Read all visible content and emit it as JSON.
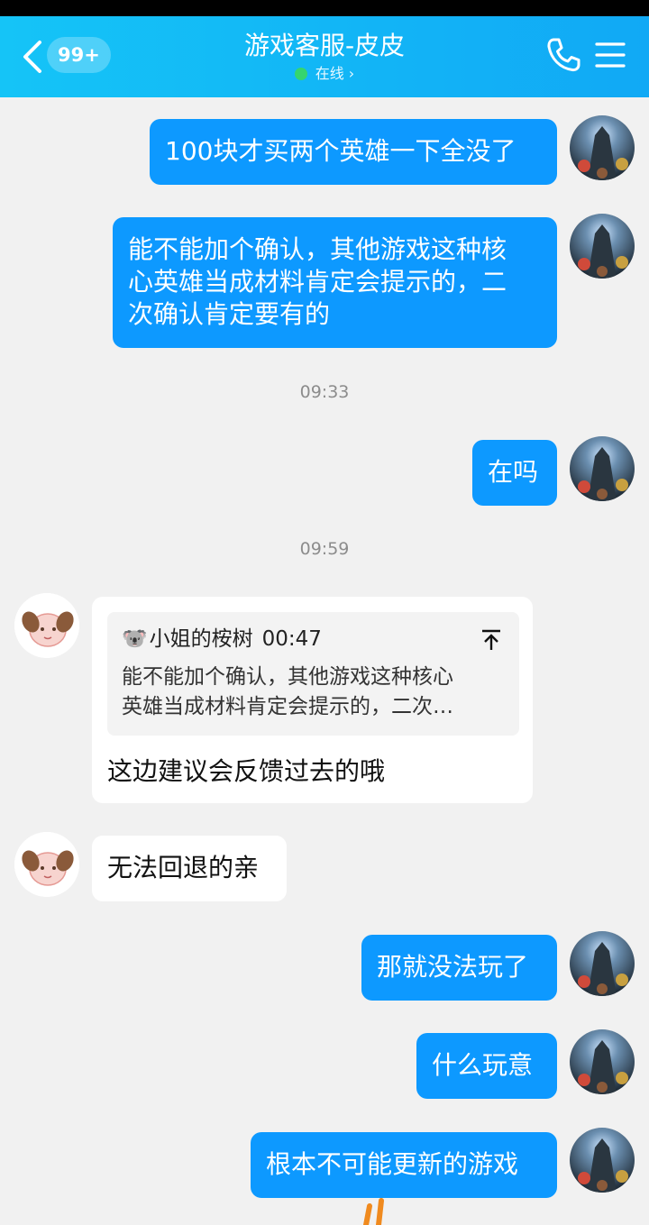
{
  "header": {
    "unread_badge": "99+",
    "title": "游戏客服-皮皮",
    "status": "在线",
    "status_chevron": "›",
    "icons": {
      "back": "chevron-left-icon",
      "call": "phone-icon",
      "menu": "menu-icon"
    }
  },
  "colors": {
    "header": "#12b5f6",
    "outgoing_bubble": "#0d99ff",
    "online_dot": "#35d56e",
    "background": "#f1f1f1"
  },
  "messages": [
    {
      "direction": "outgoing",
      "text": "100块才买两个英雄一下全没了"
    },
    {
      "direction": "outgoing",
      "lines": [
        "能不能加个确认，其他游戏这种核",
        "心英雄当成材料肯定会提示的，二",
        "次确认肯定要有的"
      ]
    },
    {
      "type": "timestamp",
      "text": "09:33"
    },
    {
      "direction": "outgoing",
      "text": "在吗"
    },
    {
      "type": "timestamp",
      "text": "09:59"
    },
    {
      "direction": "incoming",
      "quote": {
        "emoji": "🐨",
        "author": "小姐的桉树",
        "time": "00:47",
        "lines": [
          "能不能加个确认，其他游戏这种核心",
          "英雄当成材料肯定会提示的，二次…"
        ]
      },
      "text": "这边建议会反馈过去的哦"
    },
    {
      "direction": "incoming",
      "text": "无法回退的亲"
    },
    {
      "direction": "outgoing",
      "text": "那就没法玩了"
    },
    {
      "direction": "outgoing",
      "text": "什么玩意"
    },
    {
      "direction": "outgoing",
      "text": "根本不可能更新的游戏"
    }
  ]
}
